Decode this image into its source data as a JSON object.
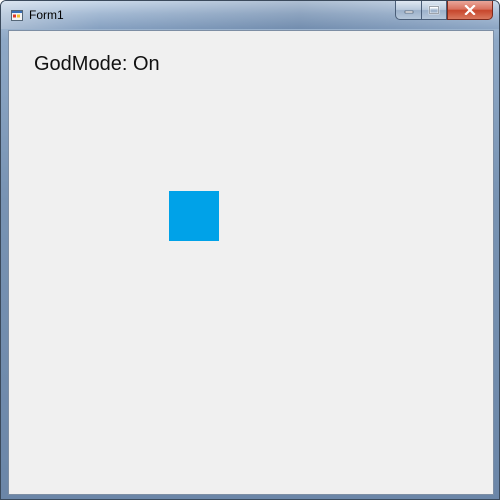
{
  "window": {
    "title": "Form1",
    "app_icon": "form-app-icon"
  },
  "caption_buttons": {
    "minimize_icon": "minimize-icon",
    "maximize_icon": "maximize-icon",
    "close_icon": "close-icon"
  },
  "client": {
    "status_label": "GodMode: On",
    "player_color": "#00a2e8"
  },
  "colors": {
    "client_background": "#f0f0f0",
    "player": "#00a2e8",
    "close_button": "#c7462c"
  }
}
